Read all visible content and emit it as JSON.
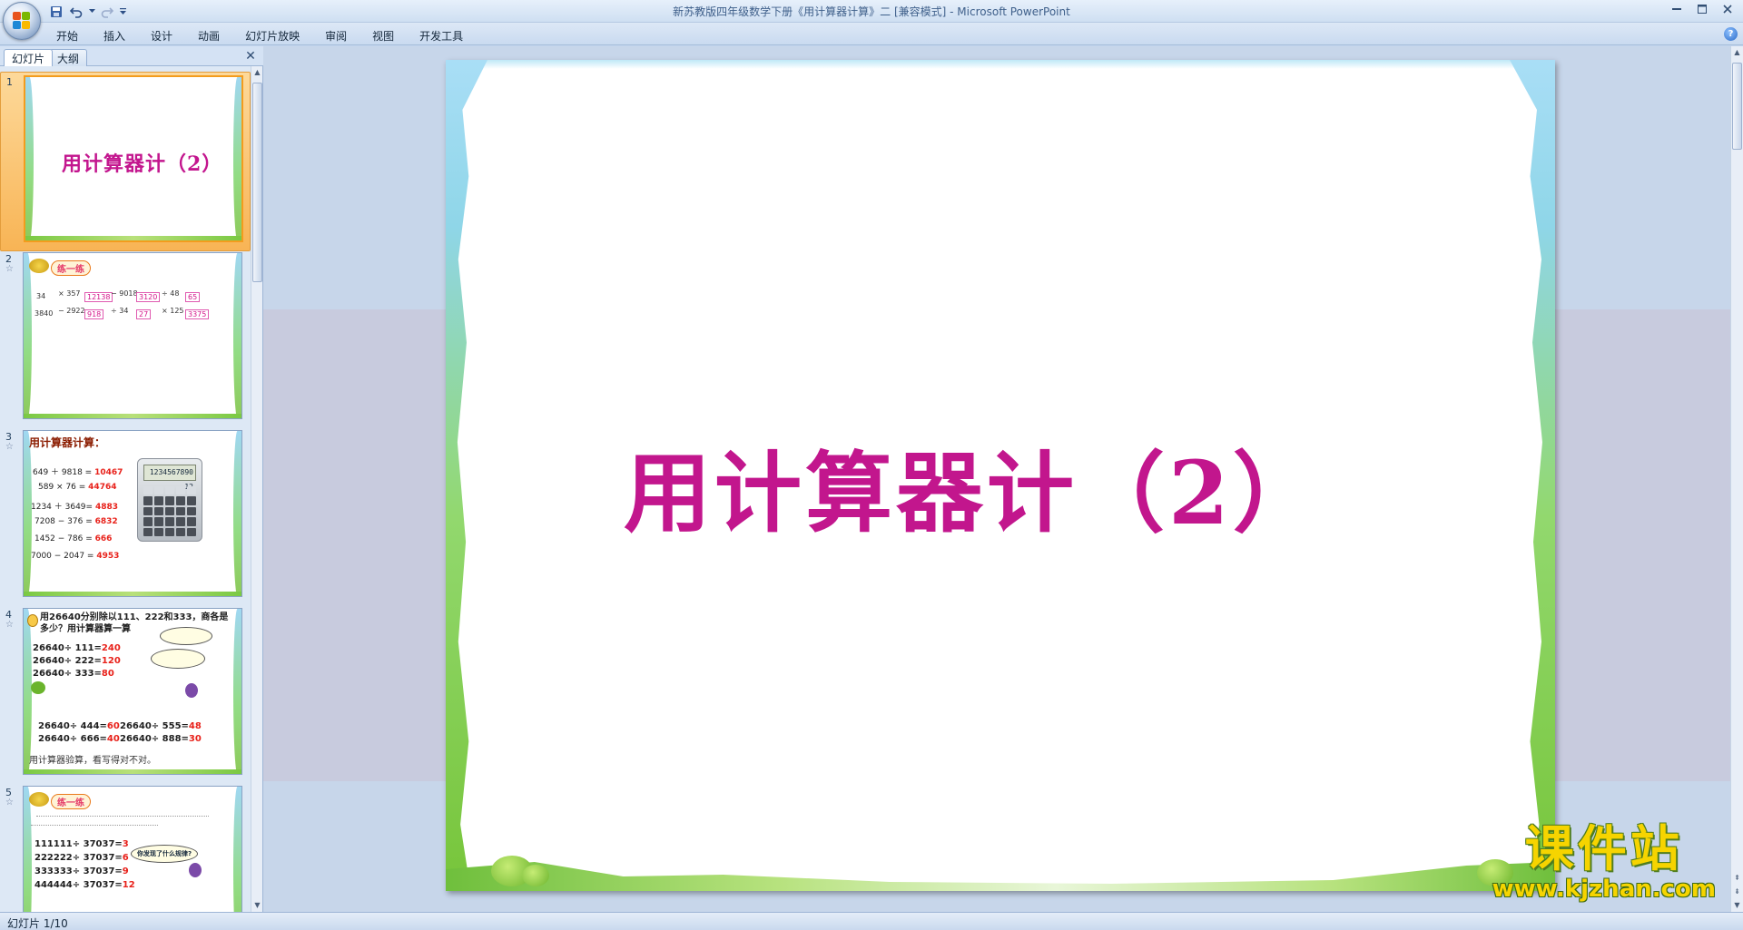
{
  "window": {
    "title": "新苏教版四年级数学下册《用计算器计算》二 [兼容模式] - Microsoft PowerPoint"
  },
  "ribbon": {
    "tabs": [
      "开始",
      "插入",
      "设计",
      "动画",
      "幻灯片放映",
      "审阅",
      "视图",
      "开发工具"
    ]
  },
  "left_pane": {
    "tabs": [
      "幻灯片",
      "大纲"
    ],
    "active_tab": "幻灯片"
  },
  "thumbnails": {
    "slide1": {
      "number": "1",
      "title": "用计算器计（2）"
    },
    "slide2": {
      "number": "2",
      "badge": "练一练",
      "row1": [
        "34",
        "× 357",
        "12138",
        "− 9018",
        "3120",
        "÷ 48",
        "65"
      ],
      "row2": [
        "3840",
        "− 2922",
        "918",
        "÷ 34",
        "27",
        "× 125",
        "3375"
      ]
    },
    "slide3": {
      "number": "3",
      "title": "用计算器计算：",
      "lines": [
        {
          "expr": "649 ＋ 9818 =",
          "answer": "10467"
        },
        {
          "expr": "589 × 76 =",
          "answer": "44764"
        },
        {
          "expr": "1234 ＋ 3649=",
          "answer": "4883"
        },
        {
          "expr": "7208 − 376 =",
          "answer": "6832"
        },
        {
          "expr": "1452 − 786 =",
          "answer": "666"
        },
        {
          "expr": "7000 − 2047 =",
          "answer": "4953"
        }
      ],
      "calc_display": "1234567890 12"
    },
    "slide4": {
      "number": "4",
      "question": "用26640分别除以111、222和333，商各是多少？用计算器算一算",
      "lines": [
        {
          "expr": "26640÷ 111=",
          "answer": "240"
        },
        {
          "expr": "26640÷ 222=",
          "answer": "120"
        },
        {
          "expr": "26640÷ 333=",
          "answer": "80"
        }
      ],
      "pairs": [
        {
          "left": "26640÷ 444=",
          "left_ans": "60",
          "right": "26640÷ 555=",
          "right_ans": "48"
        },
        {
          "left": "26640÷ 666=",
          "left_ans": "40",
          "right": "26640÷ 888=",
          "right_ans": "30"
        }
      ],
      "footer": "用计算器验算，看写得对不对。"
    },
    "slide5": {
      "number": "5",
      "badge": "练一练",
      "lines": [
        {
          "expr": "111111÷ 37037=",
          "answer": "3"
        },
        {
          "expr": "222222÷ 37037=",
          "answer": "6"
        },
        {
          "expr": "333333÷ 37037=",
          "answer": "9"
        },
        {
          "expr": "444444÷ 37037=",
          "answer": "12"
        }
      ],
      "bubble": "你发现了什么规律?"
    }
  },
  "main_slide": {
    "title": "用计算器计（2）"
  },
  "watermark": {
    "big": "课件站",
    "url": "www.kjzhan.com"
  },
  "status": {
    "text": "幻灯片 1/10"
  }
}
